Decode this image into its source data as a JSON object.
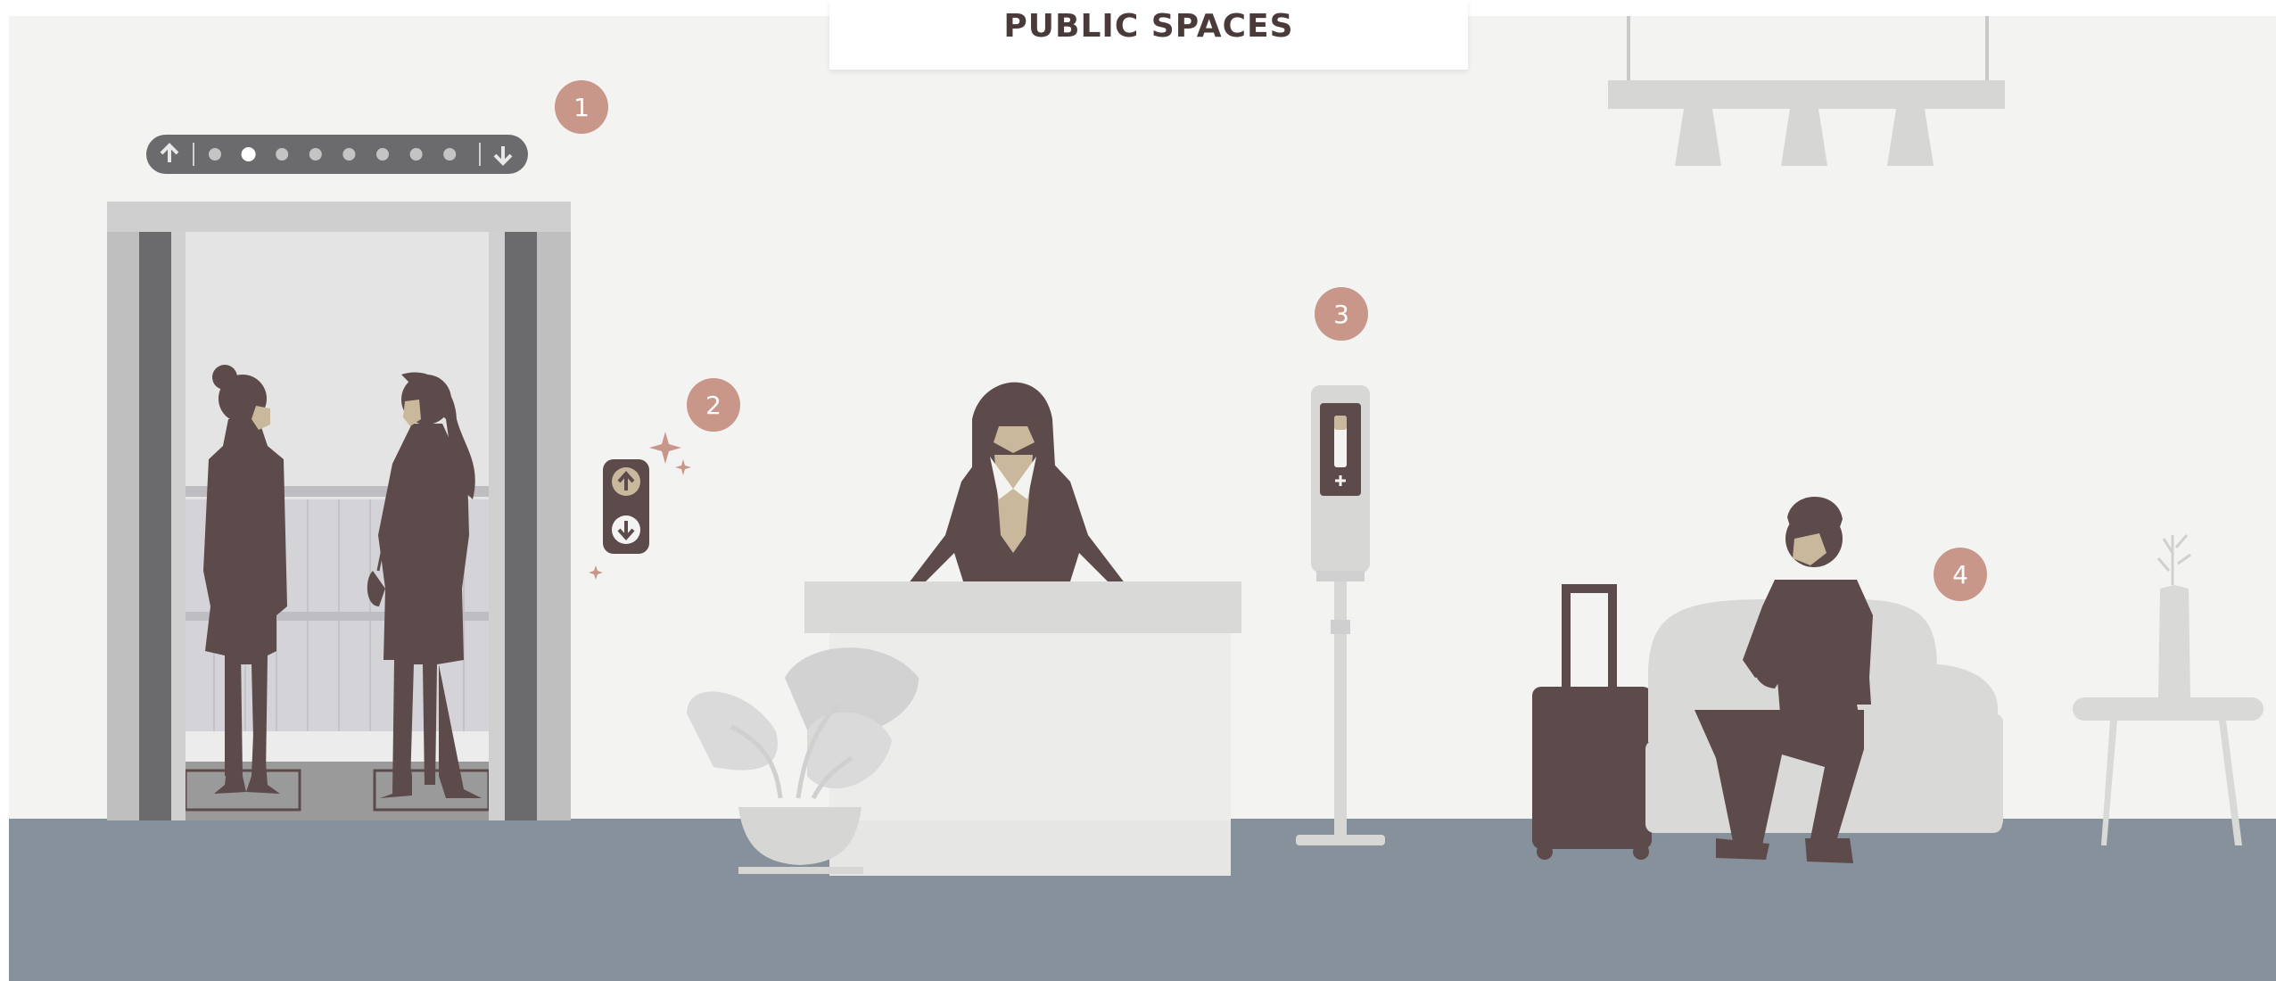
{
  "header": {
    "title": "PUBLIC SPACES"
  },
  "markers": [
    {
      "label": "1",
      "topic": "elevator"
    },
    {
      "label": "2",
      "topic": "elevator-call-buttons"
    },
    {
      "label": "3",
      "topic": "hand-sanitizer-station"
    },
    {
      "label": "4",
      "topic": "lobby-seating"
    }
  ],
  "elevator_indicator": {
    "floors_shown": 8,
    "current_floor": 2
  },
  "colors": {
    "wall": "#f3f3f1",
    "floor": "#86919c",
    "silhouette": "#5c4b4a",
    "mask": "#c9b89c",
    "marker": "#c8978a",
    "furniture": "#d9d9d7"
  }
}
